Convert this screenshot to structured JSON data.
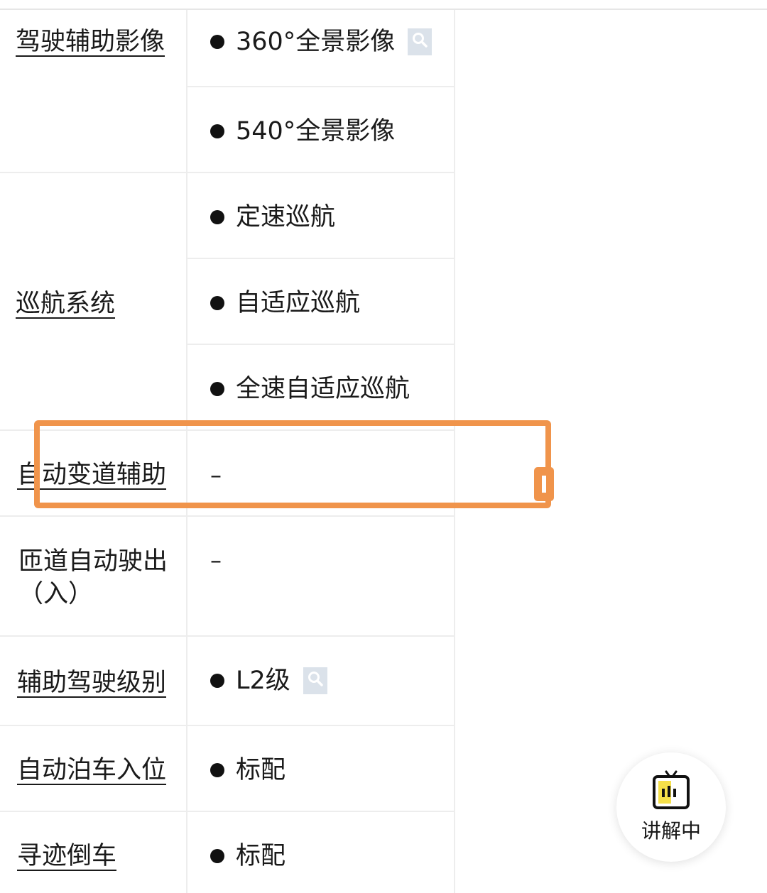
{
  "rows": [
    {
      "label": "驾驶辅助影像",
      "items": [
        "360°全景影像",
        "540°全景影像"
      ]
    },
    {
      "label": "巡航系统",
      "items": [
        "定速巡航",
        "自适应巡航",
        "全速自适应巡航"
      ]
    },
    {
      "label": "自动变道辅助",
      "value": "–"
    },
    {
      "label": "匝道自动驶出（入）",
      "value": "–"
    },
    {
      "label": "辅助驾驶级别",
      "items": [
        "L2级"
      ]
    },
    {
      "label": "自动泊车入位",
      "items": [
        "标配"
      ]
    },
    {
      "label": "寻迹倒车",
      "items": [
        "标配"
      ]
    }
  ],
  "fab": {
    "icon": "tv-icon",
    "label": "讲解中"
  },
  "colors": {
    "highlight": "#f0944b",
    "grid": "#ededed",
    "search_icon_bg": "#dbe2ea"
  }
}
